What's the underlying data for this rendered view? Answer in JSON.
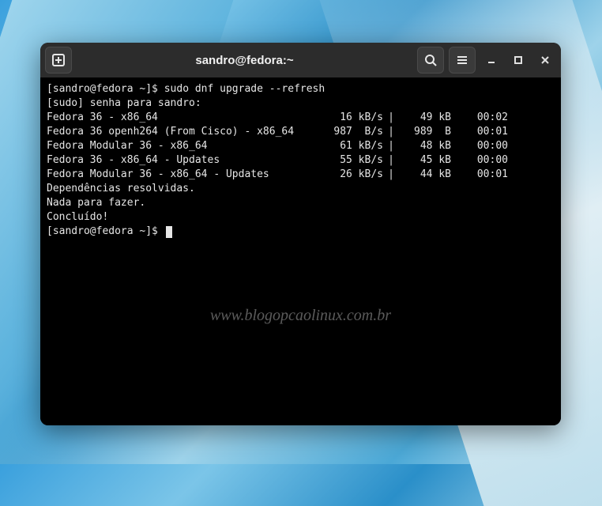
{
  "window": {
    "title": "sandro@fedora:~"
  },
  "terminal": {
    "prompt1_prefix": "[sandro@fedora ~]$ ",
    "command": "sudo dnf upgrade --refresh",
    "sudo_line": "[sudo] senha para sandro:",
    "repos": [
      {
        "name": "Fedora 36 - x86_64",
        "speed": "16 kB/s",
        "size": "49 kB",
        "time": "00:02"
      },
      {
        "name": "Fedora 36 openh264 (From Cisco) - x86_64",
        "speed": "987  B/s",
        "size": "989  B",
        "time": "00:01"
      },
      {
        "name": "Fedora Modular 36 - x86_64",
        "speed": "61 kB/s",
        "size": "48 kB",
        "time": "00:00"
      },
      {
        "name": "Fedora 36 - x86_64 - Updates",
        "speed": "55 kB/s",
        "size": "45 kB",
        "time": "00:00"
      },
      {
        "name": "Fedora Modular 36 - x86_64 - Updates",
        "speed": "26 kB/s",
        "size": "44 kB",
        "time": "00:01"
      }
    ],
    "msg_resolved": "Dependências resolvidas.",
    "msg_nothing": "Nada para fazer.",
    "msg_done": "Concluído!",
    "prompt2_prefix": "[sandro@fedora ~]$ "
  },
  "watermark": "www.blogopcaolinux.com.br"
}
